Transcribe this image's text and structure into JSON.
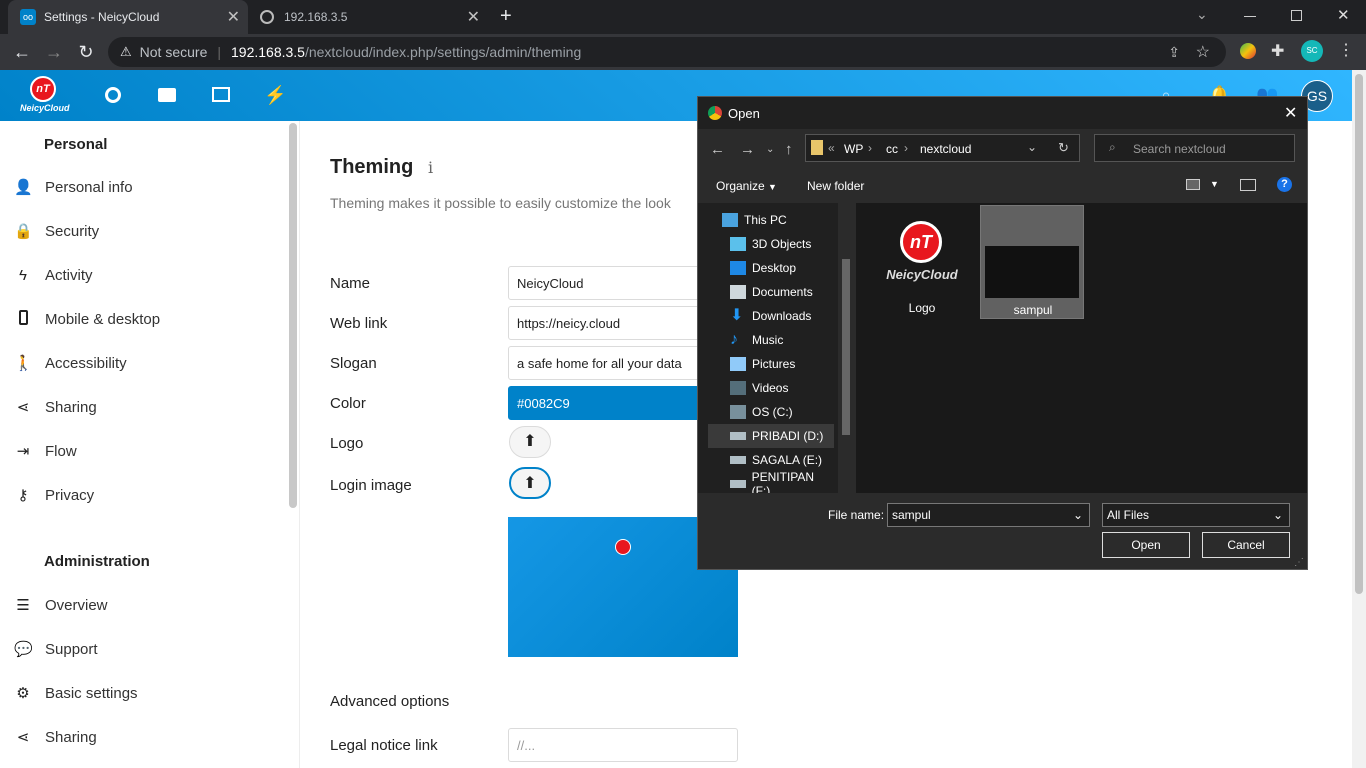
{
  "browser": {
    "tabs": [
      {
        "title": "Settings - NeicyCloud",
        "close": "✕"
      },
      {
        "title": "192.168.3.5",
        "close": "✕"
      }
    ],
    "new_tab": "+",
    "security_label": "Not secure",
    "url_host": "192.168.3.5",
    "url_path": "/nextcloud/index.php/settings/admin/theming",
    "profile_initials": "SC"
  },
  "header": {
    "logo_text": "NeicyCloud",
    "logo_mark": "nT",
    "avatar_initials": "GS"
  },
  "sidebar": {
    "personal_heading": "Personal",
    "personal_items": [
      {
        "label": "Personal info",
        "icon": "person-icon"
      },
      {
        "label": "Security",
        "icon": "lock-icon"
      },
      {
        "label": "Activity",
        "icon": "lightning-icon"
      },
      {
        "label": "Mobile & desktop",
        "icon": "phone-icon"
      },
      {
        "label": "Accessibility",
        "icon": "accessibility-icon"
      },
      {
        "label": "Sharing",
        "icon": "share-icon"
      },
      {
        "label": "Flow",
        "icon": "flow-icon"
      },
      {
        "label": "Privacy",
        "icon": "key-icon"
      }
    ],
    "admin_heading": "Administration",
    "admin_items": [
      {
        "label": "Overview",
        "icon": "list-icon"
      },
      {
        "label": "Support",
        "icon": "chat-icon"
      },
      {
        "label": "Basic settings",
        "icon": "gear-icon"
      },
      {
        "label": "Sharing",
        "icon": "share-icon"
      }
    ]
  },
  "main": {
    "title": "Theming",
    "info_icon": "i",
    "description": "Theming makes it possible to easily customize the look",
    "fields": {
      "name_label": "Name",
      "name_value": "NeicyCloud",
      "weblink_label": "Web link",
      "weblink_value": "https://neicy.cloud",
      "slogan_label": "Slogan",
      "slogan_value": "a safe home for all your data",
      "color_label": "Color",
      "color_value": "#0082C9",
      "logo_label": "Logo",
      "login_image_label": "Login image"
    },
    "advanced_heading": "Advanced options",
    "legal_label": "Legal notice link",
    "legal_placeholder": "//...",
    "accent_color": "#0082c9"
  },
  "dialog": {
    "title": "Open",
    "breadcrumb": [
      "WP",
      "cc",
      "nextcloud"
    ],
    "search_placeholder": "Search nextcloud",
    "organize_label": "Organize",
    "new_folder_label": "New folder",
    "tree": [
      {
        "label": "This PC",
        "icon": "computer-icon"
      },
      {
        "label": "3D Objects",
        "icon": "cube-icon"
      },
      {
        "label": "Desktop",
        "icon": "desktop-icon"
      },
      {
        "label": "Documents",
        "icon": "document-icon"
      },
      {
        "label": "Downloads",
        "icon": "download-icon"
      },
      {
        "label": "Music",
        "icon": "music-icon"
      },
      {
        "label": "Pictures",
        "icon": "picture-icon"
      },
      {
        "label": "Videos",
        "icon": "video-icon"
      },
      {
        "label": "OS (C:)",
        "icon": "drive-icon"
      },
      {
        "label": "PRIBADI (D:)",
        "icon": "drive-icon"
      },
      {
        "label": "SAGALA (E:)",
        "icon": "drive-icon"
      },
      {
        "label": "PENITIPAN (F:)",
        "icon": "drive-icon"
      }
    ],
    "files": [
      {
        "name": "Logo"
      },
      {
        "name": "sampul"
      }
    ],
    "filename_label": "File name:",
    "filename_value": "sampul",
    "filter_value": "All Files",
    "open_label": "Open",
    "cancel_label": "Cancel"
  }
}
